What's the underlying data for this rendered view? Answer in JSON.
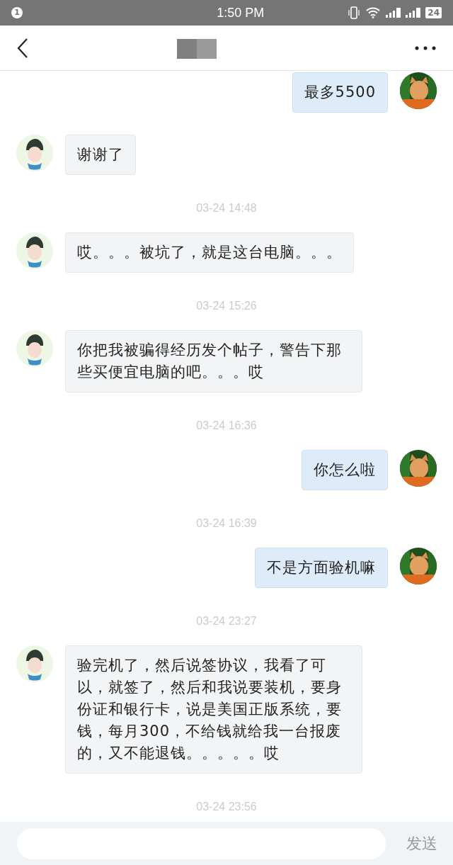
{
  "status_bar": {
    "notification_count": "1",
    "time": "1:50 PM",
    "battery": "24"
  },
  "messages": [
    {
      "kind": "outgoing",
      "text": "最多5500"
    },
    {
      "kind": "incoming",
      "text": "谢谢了"
    },
    {
      "kind": "timestamp",
      "text": "03-24 14:48"
    },
    {
      "kind": "incoming",
      "text": "哎。。。被坑了，就是这台电脑。。。"
    },
    {
      "kind": "timestamp",
      "text": "03-24 15:26"
    },
    {
      "kind": "incoming",
      "text": "你把我被骗得经历发个帖子，警告下那些买便宜电脑的吧。。。哎"
    },
    {
      "kind": "timestamp",
      "text": "03-24 16:36"
    },
    {
      "kind": "outgoing",
      "text": "你怎么啦"
    },
    {
      "kind": "timestamp",
      "text": "03-24 16:39"
    },
    {
      "kind": "outgoing",
      "text": "不是方面验机嘛"
    },
    {
      "kind": "timestamp",
      "text": "03-24 23:27"
    },
    {
      "kind": "incoming",
      "text": "验完机了，然后说签协议，我看了可以，就签了，然后和我说要装机，要身份证和银行卡，说是美国正版系统，要钱，每月300，不给钱就给我一台报废的，又不能退钱。。。。。哎"
    },
    {
      "kind": "timestamp",
      "text": "03-24 23:56"
    }
  ],
  "composer": {
    "send_label": "发送"
  }
}
